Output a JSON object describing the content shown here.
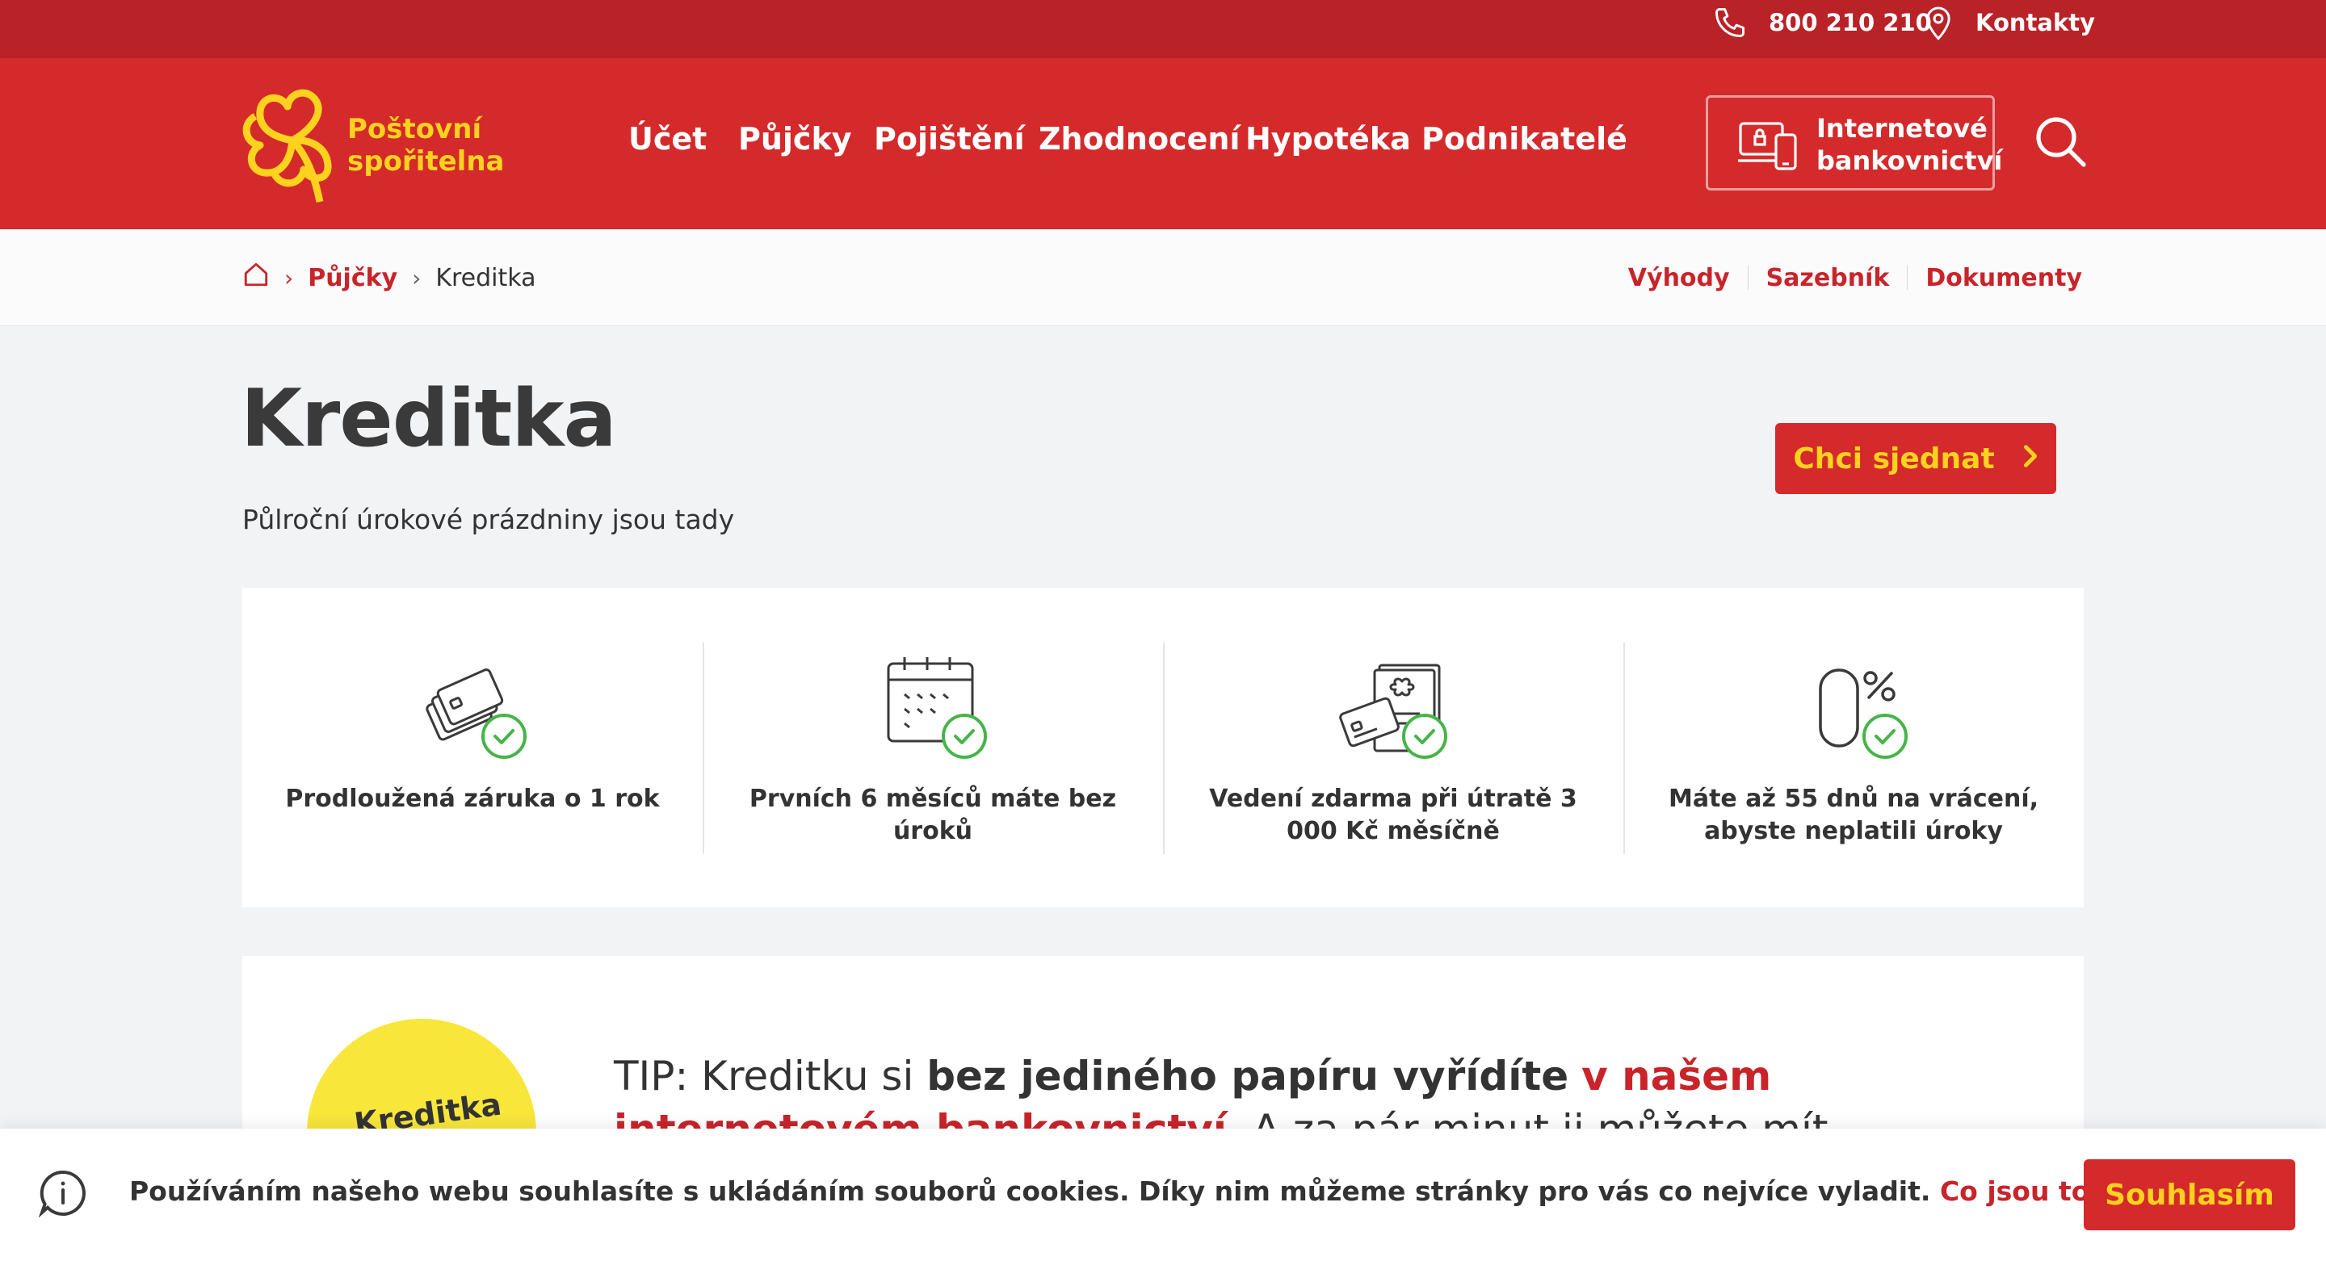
{
  "topbar": {
    "phone": "800 210 210",
    "contacts": "Kontakty"
  },
  "brand": {
    "line1": "Poštovní",
    "line2": "spořitelna"
  },
  "nav": {
    "items": [
      "Účet",
      "Půjčky",
      "Pojištění",
      "Zhodnocení",
      "Hypotéka",
      "Podnikatelé"
    ]
  },
  "ib": {
    "line1": "Internetové",
    "line2": "bankovnictví"
  },
  "breadcrumb": {
    "loans": "Půjčky",
    "current": "Kreditka"
  },
  "anchors": [
    "Výhody",
    "Sazebník",
    "Dokumenty"
  ],
  "page": {
    "title": "Kreditka",
    "subtitle": "Půlroční úrokové prázdniny jsou tady",
    "cta": "Chci sjednat"
  },
  "benefits": [
    {
      "icon": "cards-check-icon",
      "text": "Prodloužená záruka o 1 rok"
    },
    {
      "icon": "calendar-check-icon",
      "text": "Prvních 6 měsíců máte bez úroků"
    },
    {
      "icon": "card-document-check-icon",
      "text": "Vedení zdarma při útratě 3 000 Kč měsíčně"
    },
    {
      "icon": "zero-percent-check-icon",
      "text": "Máte až 55 dnů na vrácení, abyste neplatili úroky"
    }
  ],
  "tip": {
    "badge": "Kreditka",
    "prefix": "TIP: Kreditku si ",
    "bold": "bez jediného papíru vyřídíte",
    "link": "v našem internetovém bankovnictví",
    "rest": ". A za pár minut ji můžete mít schválenou. Jednoduše, rychle."
  },
  "cookie": {
    "message": "Používáním našeho webu souhlasíte s ukládáním souborů cookies. Díky nim můžeme stránky pro vás co nejvíce vyladit.",
    "link": "Co jsou to cookies?",
    "agree": "Souhlasím"
  },
  "colors": {
    "brand_red": "#d42a2b",
    "top_red": "#b92227",
    "brand_yellow": "#ffd21f",
    "check_green": "#45b548"
  }
}
